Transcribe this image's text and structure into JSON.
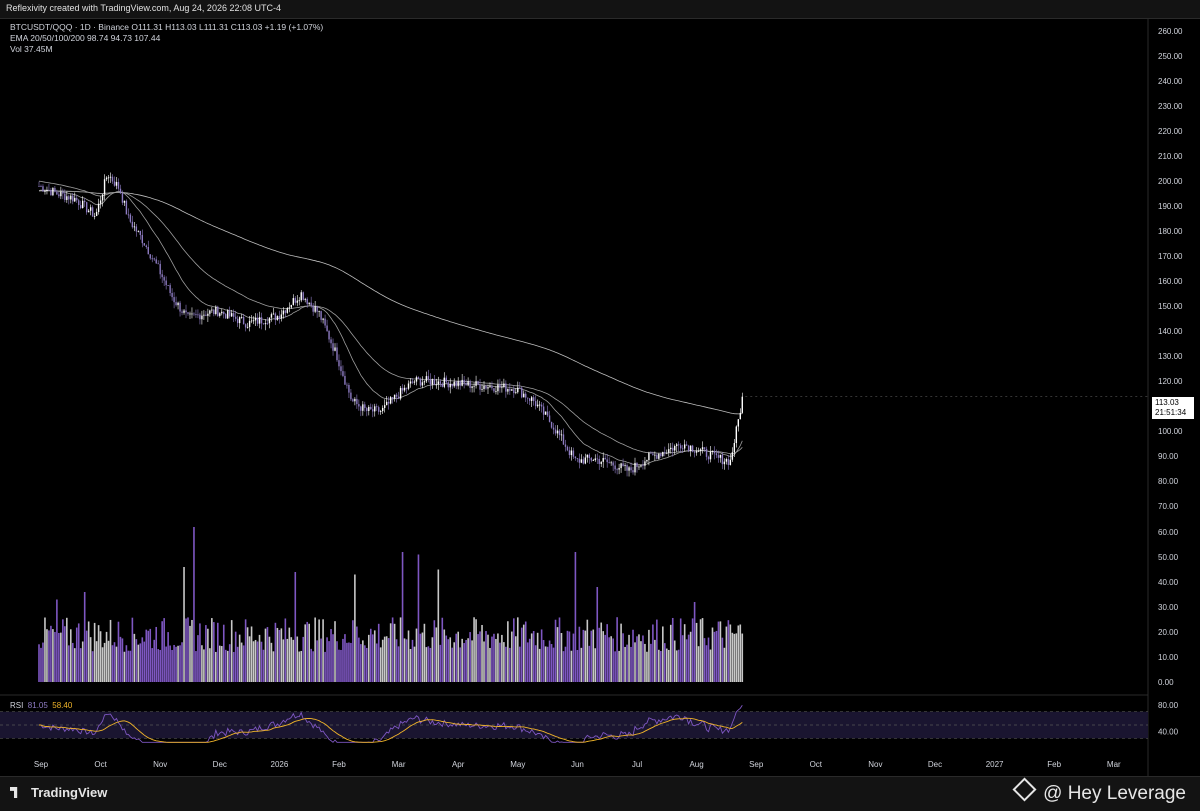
{
  "header": {
    "title": "Reflexivity created with TradingView.com, Aug 24, 2026 22:08 UTC-4"
  },
  "legend": {
    "symbol_line": "BTCUSDT/QQQ · 1D · Binance  O111.31  H113.03  L111.31  C113.03  +1.19 (+1.07%)",
    "ema_line": "EMA 20/50/100/200  98.74  94.73  107.44",
    "vol_line": "Vol  37.45M"
  },
  "price_label": {
    "price": "113.03",
    "countdown": "21:51:34"
  },
  "rsi": {
    "label": "RSI",
    "value": "81.05",
    "ma": "58.40"
  },
  "footer": {
    "brand": "TradingView",
    "watermark": "@ Hey Leverage"
  },
  "colors": {
    "background": "#000000",
    "candle_up": "#ffffff",
    "candle_down": "#8e7cc3",
    "ema": "#9e9e9e",
    "rsi_line": "#7e57c2",
    "rsi_ma": "#f0b429",
    "rsi_band": "#1a1530"
  },
  "chart_data": {
    "type": "candlestick",
    "x_axis_ticks": [
      "Sep",
      "Oct",
      "Nov",
      "Dec",
      "2026",
      "Feb",
      "Mar",
      "Apr",
      "May",
      "Jun",
      "Jul",
      "Aug",
      "Sep",
      "Oct",
      "Nov",
      "Dec",
      "2027",
      "Feb",
      "Mar"
    ],
    "price_axis_ticks": [
      "260.00",
      "250.00",
      "240.00",
      "230.00",
      "220.00",
      "210.00",
      "200.00",
      "190.00",
      "180.00",
      "170.00",
      "160.00",
      "150.00",
      "140.00",
      "130.00",
      "120.00",
      "110.00",
      "100.00",
      "90.00",
      "80.00",
      "70.00"
    ],
    "price_range": [
      70,
      264
    ],
    "close_path": [
      {
        "t": 0.0,
        "v": 198
      },
      {
        "t": 0.3,
        "v": 195
      },
      {
        "t": 0.6,
        "v": 193
      },
      {
        "t": 0.95,
        "v": 186
      },
      {
        "t": 1.15,
        "v": 203
      },
      {
        "t": 1.35,
        "v": 197
      },
      {
        "t": 1.5,
        "v": 185
      },
      {
        "t": 1.75,
        "v": 176
      },
      {
        "t": 2.0,
        "v": 165
      },
      {
        "t": 2.25,
        "v": 153
      },
      {
        "t": 2.5,
        "v": 145
      },
      {
        "t": 2.75,
        "v": 147
      },
      {
        "t": 3.0,
        "v": 148
      },
      {
        "t": 3.5,
        "v": 143
      },
      {
        "t": 4.0,
        "v": 146
      },
      {
        "t": 4.4,
        "v": 155
      },
      {
        "t": 4.7,
        "v": 147
      },
      {
        "t": 5.0,
        "v": 130
      },
      {
        "t": 5.25,
        "v": 112
      },
      {
        "t": 5.5,
        "v": 108
      },
      {
        "t": 5.75,
        "v": 108
      },
      {
        "t": 6.0,
        "v": 114
      },
      {
        "t": 6.3,
        "v": 120
      },
      {
        "t": 6.6,
        "v": 120
      },
      {
        "t": 7.0,
        "v": 119
      },
      {
        "t": 7.5,
        "v": 118
      },
      {
        "t": 8.0,
        "v": 117
      },
      {
        "t": 8.3,
        "v": 112
      },
      {
        "t": 8.6,
        "v": 103
      },
      {
        "t": 9.0,
        "v": 88
      },
      {
        "t": 9.3,
        "v": 89
      },
      {
        "t": 9.6,
        "v": 87
      },
      {
        "t": 9.9,
        "v": 84
      },
      {
        "t": 10.2,
        "v": 89
      },
      {
        "t": 10.5,
        "v": 92
      },
      {
        "t": 10.8,
        "v": 95
      },
      {
        "t": 11.1,
        "v": 92
      },
      {
        "t": 11.4,
        "v": 89
      },
      {
        "t": 11.6,
        "v": 88
      },
      {
        "t": 11.7,
        "v": 100
      },
      {
        "t": 11.8,
        "v": 113
      }
    ],
    "ema_values": {
      "ema20": 98.74,
      "ema50": 94.73,
      "ema100": 107.44
    },
    "volume_axis_ticks": [
      "60.00",
      "50.00",
      "40.00",
      "30.00",
      "20.00",
      "10.00",
      "0.00"
    ],
    "volume_range": [
      0,
      65
    ],
    "volume_spikes": [
      {
        "t": 0.3,
        "v": 33
      },
      {
        "t": 0.75,
        "v": 36
      },
      {
        "t": 2.6,
        "v": 62
      },
      {
        "t": 2.45,
        "v": 46
      },
      {
        "t": 4.3,
        "v": 44
      },
      {
        "t": 5.3,
        "v": 43
      },
      {
        "t": 6.1,
        "v": 52
      },
      {
        "t": 6.35,
        "v": 51
      },
      {
        "t": 6.7,
        "v": 45
      },
      {
        "t": 9.0,
        "v": 52
      },
      {
        "t": 9.35,
        "v": 38
      },
      {
        "t": 11.0,
        "v": 32
      },
      {
        "t": 11.6,
        "v": 23
      },
      {
        "t": 11.75,
        "v": 23
      }
    ],
    "rsi_axis_ticks": [
      "80.00",
      "40.00"
    ],
    "rsi_range": [
      20,
      88
    ],
    "rsi_bands": [
      70,
      50,
      30
    ]
  }
}
